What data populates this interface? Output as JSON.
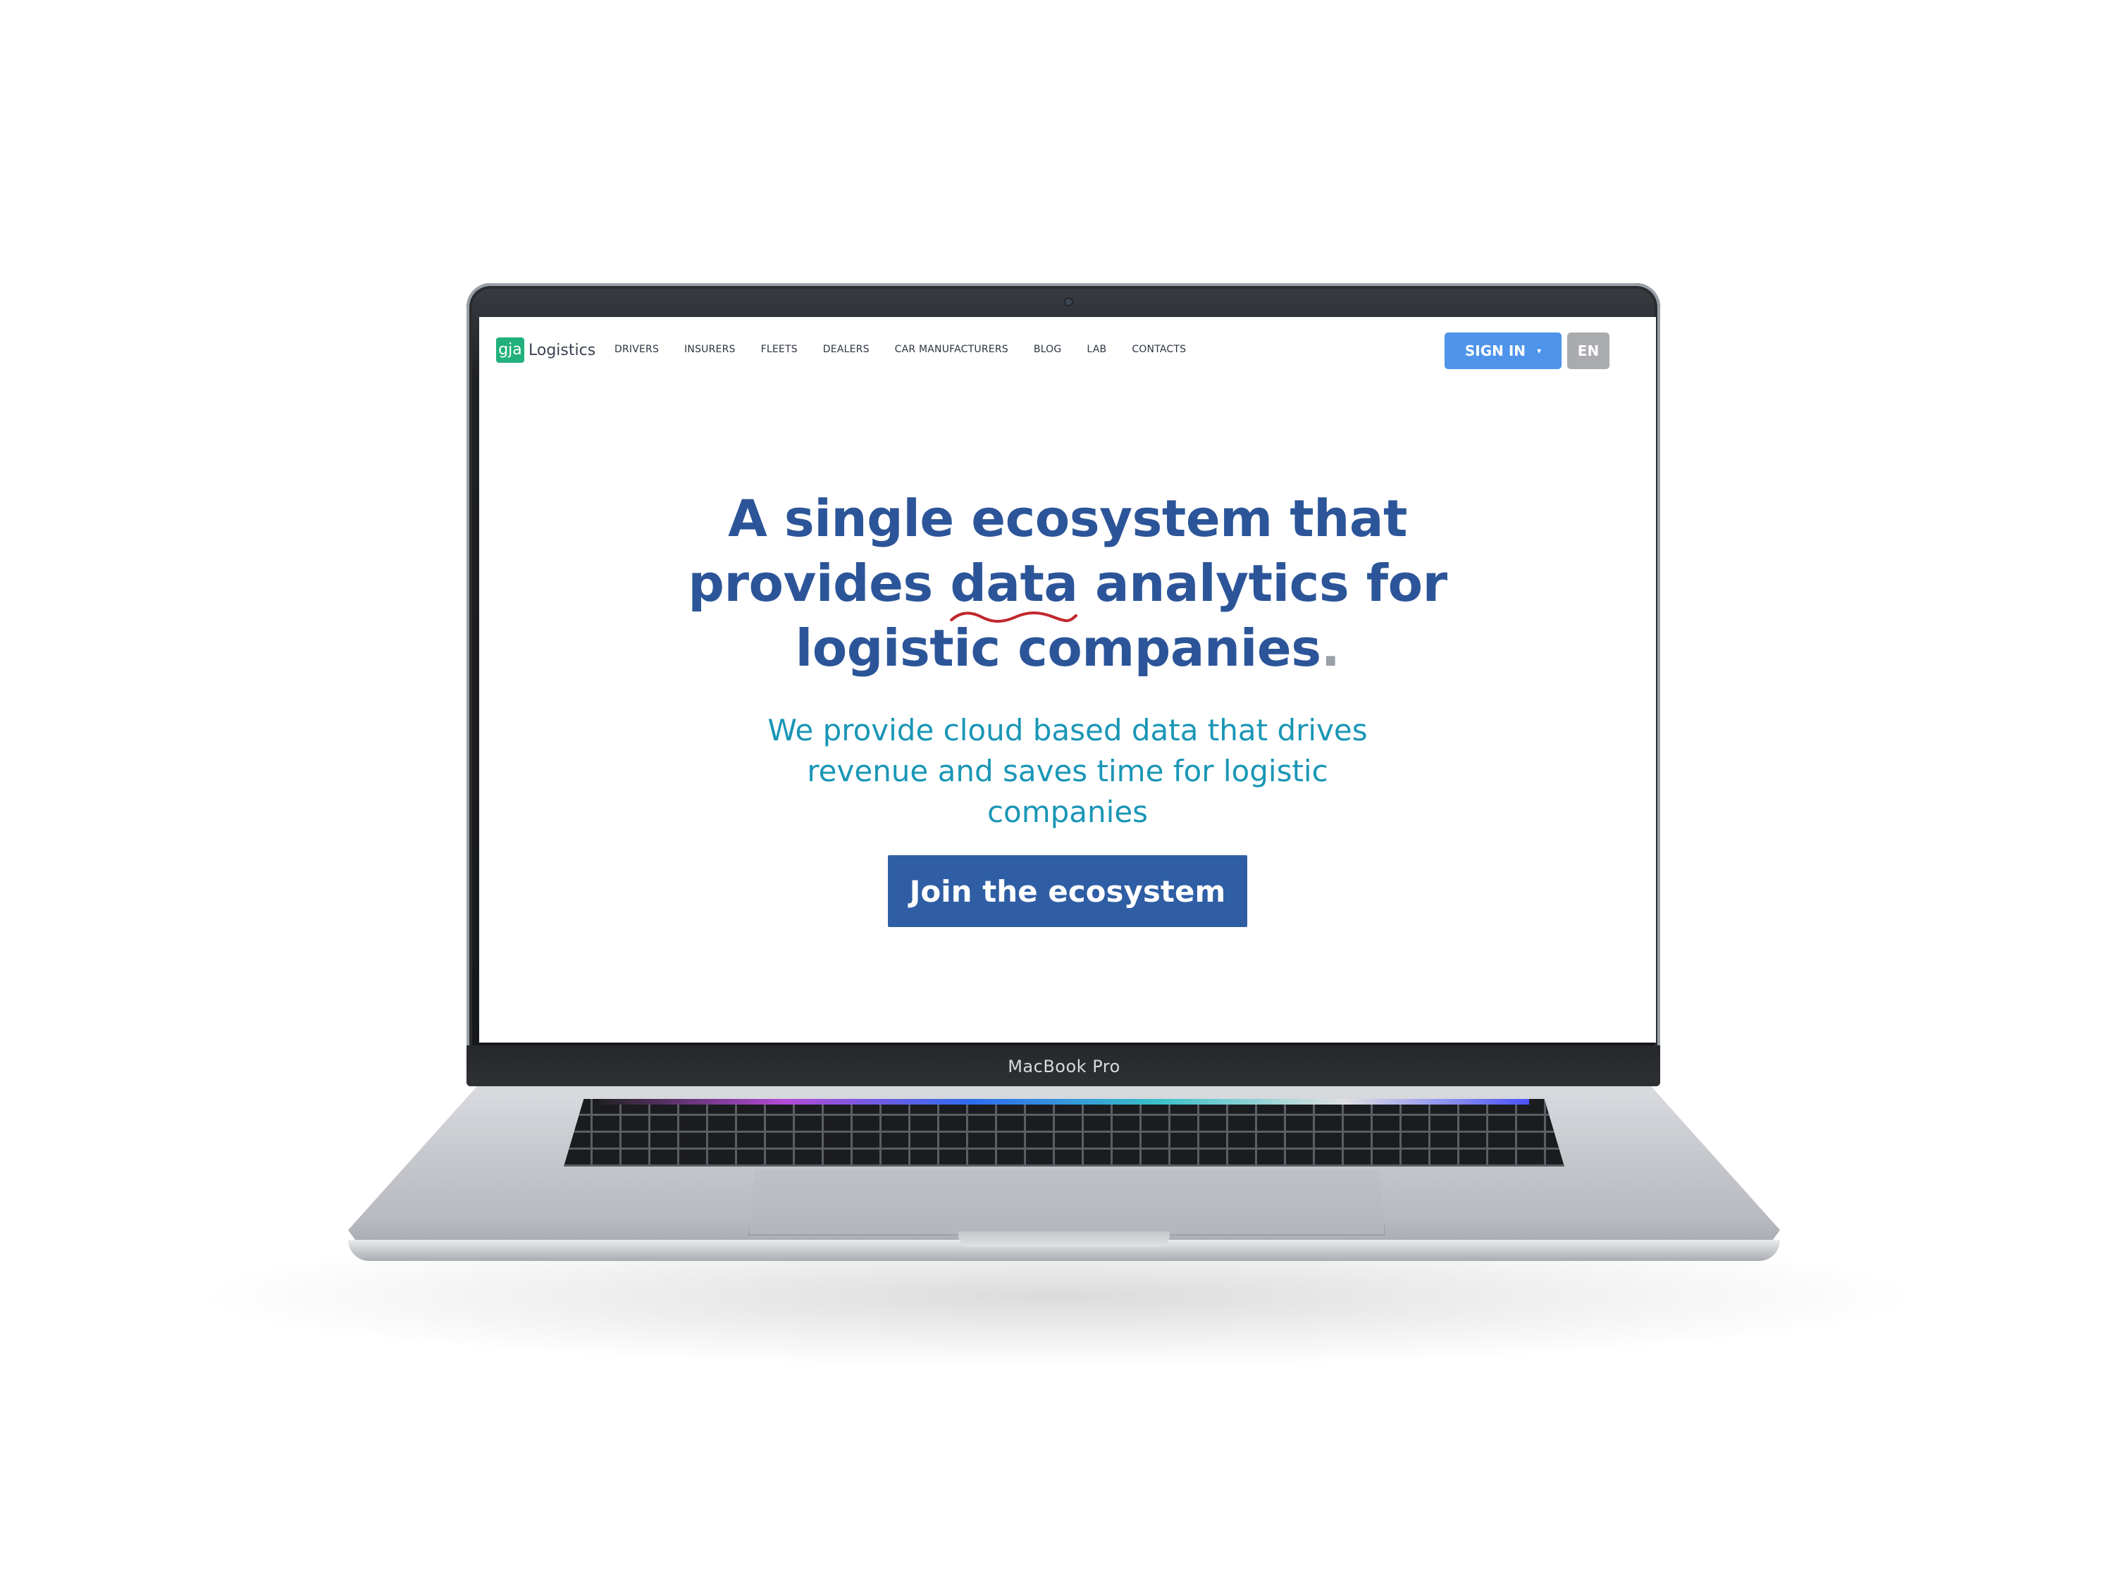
{
  "device": {
    "label": "MacBook Pro"
  },
  "nav": {
    "brand_badge": "gja",
    "brand_name": "Logistics",
    "links": [
      "DRIVERS",
      "INSURERS",
      "FLEETS",
      "DEALERS",
      "CAR MANUFACTURERS",
      "BLOG",
      "LAB",
      "CONTACTS"
    ],
    "signin_label": "SIGN IN",
    "language": "EN"
  },
  "hero": {
    "title_line1": "A single ecosystem that",
    "title_line2_pre": "provides ",
    "title_line2_highlight": "data",
    "title_line2_post": " analytics for",
    "title_line3": "logistic companies",
    "title_period": ".",
    "subtitle": "We provide cloud based data that drives revenue and saves time for logistic companies",
    "cta_label": "Join the ecosystem"
  },
  "colors": {
    "title": "#2c5599",
    "subtitle": "#1a96b6",
    "cta": "#2f5ea4",
    "signin": "#4d94ea",
    "brand": "#22b07d",
    "squiggle": "#c0282d"
  }
}
